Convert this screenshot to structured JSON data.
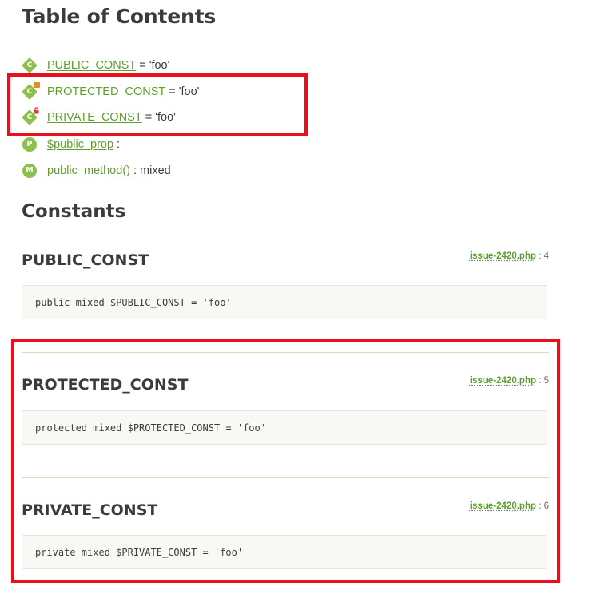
{
  "toc": {
    "title": "Table of Contents",
    "items": [
      {
        "badge": "C",
        "icon": "constant-icon",
        "link": "PUBLIC_CONST",
        "rest": "= 'foo'"
      },
      {
        "badge": "C",
        "icon": "protected-constant-icon",
        "link": "PROTECTED_CONST",
        "rest": "= 'foo'"
      },
      {
        "badge": "C",
        "icon": "private-constant-icon",
        "link": "PRIVATE_CONST",
        "rest": "= 'foo'"
      },
      {
        "badge": "P",
        "icon": "property-icon",
        "link": "$public_prop",
        "rest": ":"
      },
      {
        "badge": "M",
        "icon": "method-icon",
        "link": "public_method()",
        "rest": ": mixed"
      }
    ]
  },
  "constants": {
    "title": "Constants",
    "members": [
      {
        "name": "PUBLIC_CONST",
        "file": "issue-2420.php",
        "line": ": 4",
        "code": "public mixed $PUBLIC_CONST = 'foo'"
      },
      {
        "name": "PROTECTED_CONST",
        "file": "issue-2420.php",
        "line": ": 5",
        "code": "protected mixed $PROTECTED_CONST = 'foo'"
      },
      {
        "name": "PRIVATE_CONST",
        "file": "issue-2420.php",
        "line": ": 6",
        "code": "private mixed $PRIVATE_CONST = 'foo'"
      }
    ]
  },
  "colors": {
    "accent": "#8cc04d",
    "link": "#5e9f2c",
    "highlight": "#e8101c",
    "protected_tag": "#e48b2a",
    "private_lock": "#e0393e"
  }
}
